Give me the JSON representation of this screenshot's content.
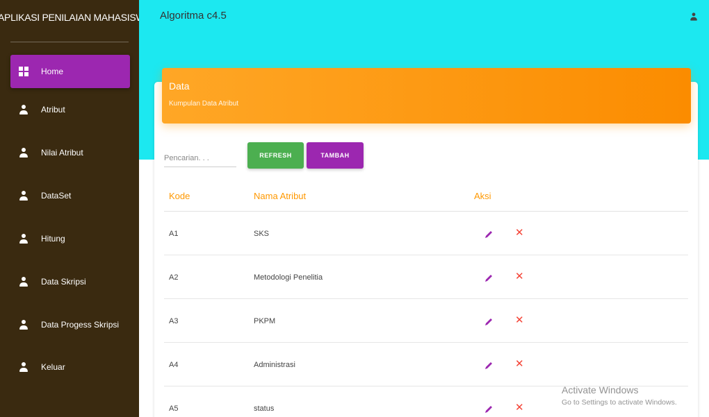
{
  "sidebar": {
    "brand": "APLIKASI PENILAIAN MAHASISWA SKRIPSI",
    "items": [
      {
        "label": "Home",
        "icon": "dashboard-icon",
        "active": true
      },
      {
        "label": "Atribut",
        "icon": "person-icon"
      },
      {
        "label": "Nilai Atribut",
        "icon": "person-icon"
      },
      {
        "label": "DataSet",
        "icon": "person-icon"
      },
      {
        "label": "Hitung",
        "icon": "person-icon"
      },
      {
        "label": "Data Skripsi",
        "icon": "person-icon"
      },
      {
        "label": "Data Progess Skripsi",
        "icon": "person-icon"
      },
      {
        "label": "Keluar",
        "icon": "person-icon"
      }
    ]
  },
  "topbar": {
    "title": "Algoritma c4.5",
    "user_icon": "person-icon"
  },
  "card": {
    "title": "Data",
    "subtitle": "Kumpulan Data Atribut"
  },
  "toolbar": {
    "search_placeholder": "Pencarian. . .",
    "refresh_label": "REFRESH",
    "add_label": "TAMBAH"
  },
  "table": {
    "headers": [
      "Kode",
      "Nama Atribut",
      "Aksi"
    ],
    "rows": [
      {
        "kode": "A1",
        "nama": "SKS"
      },
      {
        "kode": "A2",
        "nama": "Metodologi Penelitia"
      },
      {
        "kode": "A3",
        "nama": "PKPM"
      },
      {
        "kode": "A4",
        "nama": "Administrasi"
      },
      {
        "kode": "A5",
        "nama": "status"
      }
    ]
  },
  "watermark": {
    "line1": "Activate Windows",
    "line2": "Go to Settings to activate Windows."
  },
  "colors": {
    "sidebar": "#3a2a10",
    "topbar": "#1ce8f0",
    "accent_purple": "#9c27b0",
    "header_orange": "#ff9800",
    "refresh_green": "#4caf50",
    "delete_red": "#f44336"
  }
}
